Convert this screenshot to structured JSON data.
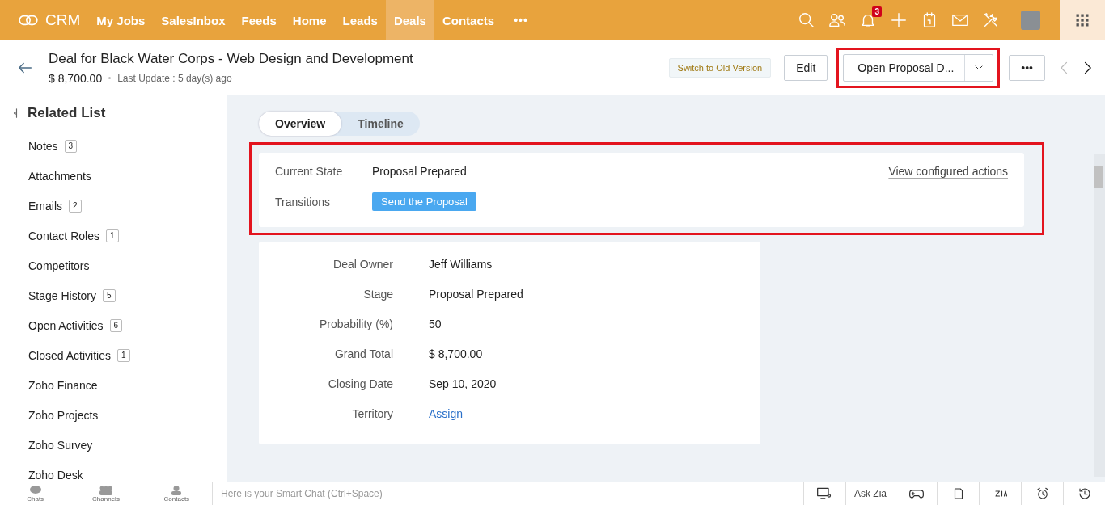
{
  "nav": {
    "brand": "CRM",
    "items": [
      {
        "label": "My Jobs",
        "selected": false
      },
      {
        "label": "SalesInbox",
        "selected": false
      },
      {
        "label": "Feeds",
        "selected": false
      },
      {
        "label": "Home",
        "selected": false
      },
      {
        "label": "Leads",
        "selected": false
      },
      {
        "label": "Deals",
        "selected": true
      },
      {
        "label": "Contacts",
        "selected": false
      }
    ],
    "more": "•••",
    "notification_count": "3"
  },
  "header": {
    "title": "Deal for Black Water Corps - Web Design and Development",
    "amount": "$ 8,700.00",
    "last_update": "Last Update : 5 day(s) ago",
    "switch_button": "Switch to Old Version",
    "edit_button": "Edit",
    "action_button": "Open Proposal D...",
    "more_button": "•••"
  },
  "related_list": {
    "title": "Related List",
    "items": [
      {
        "label": "Notes",
        "count": "3"
      },
      {
        "label": "Attachments"
      },
      {
        "label": "Emails",
        "count": "2"
      },
      {
        "label": "Contact Roles",
        "count": "1"
      },
      {
        "label": "Competitors"
      },
      {
        "label": "Stage History",
        "count": "5"
      },
      {
        "label": "Open Activities",
        "count": "6"
      },
      {
        "label": "Closed Activities",
        "count": "1"
      },
      {
        "label": "Zoho Finance"
      },
      {
        "label": "Zoho Projects"
      },
      {
        "label": "Zoho Survey"
      },
      {
        "label": "Zoho Desk"
      }
    ]
  },
  "tabs": [
    {
      "label": "Overview",
      "selected": true
    },
    {
      "label": "Timeline",
      "selected": false
    }
  ],
  "blueprint": {
    "current_state_label": "Current State",
    "current_state": "Proposal Prepared",
    "transitions_label": "Transitions",
    "transition_button": "Send the Proposal",
    "link": "View configured actions"
  },
  "fields": [
    {
      "label": "Deal Owner",
      "value": "Jeff Williams",
      "kind": "text"
    },
    {
      "label": "Stage",
      "value": "Proposal Prepared",
      "kind": "text"
    },
    {
      "label": "Probability (%)",
      "value": "50",
      "kind": "text"
    },
    {
      "label": "Grand Total",
      "value": "$ 8,700.00",
      "kind": "text"
    },
    {
      "label": "Closing Date",
      "value": "Sep 10, 2020",
      "kind": "text"
    },
    {
      "label": "Territory",
      "value": "Assign",
      "kind": "link"
    }
  ],
  "bottom_bar": {
    "items": [
      "Chats",
      "Channels",
      "Contacts"
    ],
    "chat_placeholder": "Here is your Smart Chat (Ctrl+Space)",
    "ask_zia": "Ask Zia"
  }
}
